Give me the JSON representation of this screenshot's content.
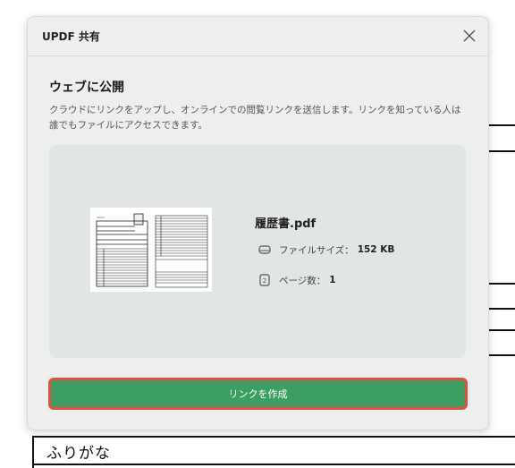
{
  "background_document": {
    "visible_text": "ふりがな"
  },
  "dialog": {
    "title": "UPDF 共有",
    "close_icon": "close-icon",
    "section_heading": "ウェブに公開",
    "description": "クラウドにリンクをアップし、オンラインでの閲覧リンクを送信します。リンクを知っている人は誰でもファイルにアクセスできます。",
    "file": {
      "name": "履歴書.pdf",
      "size_label": "ファイルサイズ：",
      "size_value": "152 KB",
      "size_icon": "drive-icon",
      "pages_label": "ページ数：",
      "pages_value": "1",
      "pages_icon": "page-count-icon"
    },
    "create_button_label": "リンクを作成"
  },
  "colors": {
    "button_green": "#3d9e61",
    "highlight_red": "#e44c45",
    "dialog_bg": "#ecefec",
    "card_bg": "#e2e6e2"
  }
}
